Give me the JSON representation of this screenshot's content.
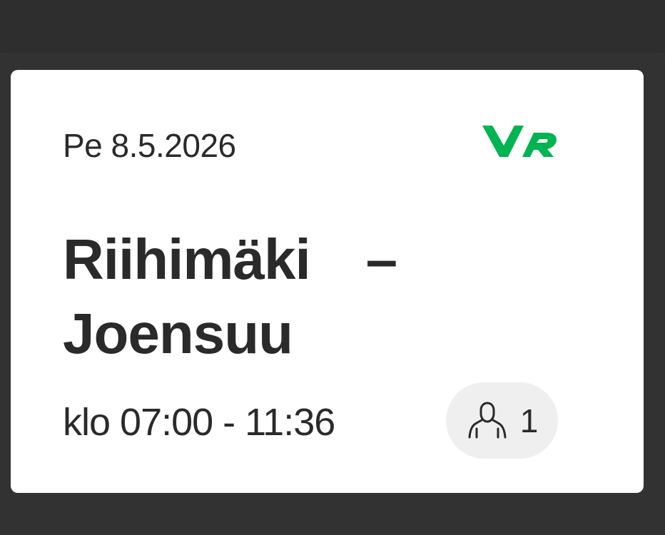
{
  "ticket": {
    "date": "Pe 8.5.2026",
    "origin": "Riihimäki",
    "dash": "–",
    "destination": "Joensuu",
    "time": "klo 07:00 - 11:36",
    "passenger_count": "1",
    "passenger_icon": "person-icon",
    "logo": "VR"
  },
  "colors": {
    "background": "#333333",
    "card": "#ffffff",
    "brand_green": "#00b451",
    "text": "#2a2a2a",
    "pill": "#efefef"
  }
}
